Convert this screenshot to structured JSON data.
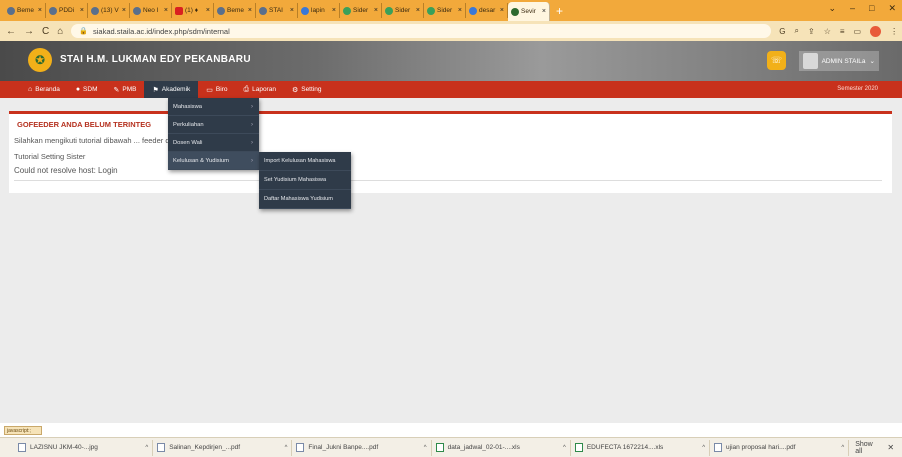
{
  "browser": {
    "tabs": [
      {
        "label": "Beme"
      },
      {
        "label": "PDDi"
      },
      {
        "label": "(13) V"
      },
      {
        "label": "Neo I"
      },
      {
        "label": "(1) ♦"
      },
      {
        "label": "Beme"
      },
      {
        "label": "STAI"
      },
      {
        "label": "lapin"
      },
      {
        "label": "Sider"
      },
      {
        "label": "Sider"
      },
      {
        "label": "Sider"
      },
      {
        "label": "desar"
      },
      {
        "label": "Sevir",
        "active": true
      }
    ],
    "new_tab": "+",
    "url": "siakad.staila.ac.id/index.php/sdm/internal"
  },
  "site": {
    "title": "STAI H.M. LUKMAN EDY PEKANBARU",
    "user": "ADMIN STAILa",
    "semester": "Semester 2020"
  },
  "menu": {
    "items": [
      {
        "label": "Beranda",
        "icon": "home-icon"
      },
      {
        "label": "SDM",
        "icon": "user-icon"
      },
      {
        "label": "PMB",
        "icon": "pin-icon"
      },
      {
        "label": "Akademik",
        "icon": "flag-icon",
        "active": true
      },
      {
        "label": "Biro",
        "icon": "folder-icon"
      },
      {
        "label": "Laporan",
        "icon": "print-icon"
      },
      {
        "label": "Setting",
        "icon": "gear-icon"
      }
    ]
  },
  "dropdown": {
    "items": [
      {
        "label": "Mahasiswa",
        "submenu": true
      },
      {
        "label": "Perkuliahan",
        "submenu": true
      },
      {
        "label": "Dosen Wali",
        "submenu": true
      },
      {
        "label": "Kelulusan & Yudisium",
        "submenu": true,
        "selected": true
      }
    ],
    "submenu": [
      {
        "label": "Import Kelulusan Mahasiswa"
      },
      {
        "label": "Set Yudisium Mahasiswa"
      },
      {
        "label": "Daftar Mahasiswa Yudisium"
      }
    ]
  },
  "main": {
    "warning_title": "GOFEEDER ANDA BELUM TERINTEG",
    "warning_text": "Silahkan mengikuti tutorial dibawah ... feeder dengan SISTER",
    "tutorial_link": "Tutorial Setting Sister",
    "error": "Could not resolve host: Login"
  },
  "status": {
    "text": "javascript:;"
  },
  "downloads": {
    "items": [
      {
        "name": "LAZISNU JKM-40-...jpg"
      },
      {
        "name": "Salinan_Kepdirjen_...pdf"
      },
      {
        "name": "Final_Jukni Banpe....pdf"
      },
      {
        "name": "data_jadwal_02-01-....xls"
      },
      {
        "name": "EDUFECTA 1672214....xls"
      },
      {
        "name": "ujian proposal hari....pdf"
      }
    ],
    "show_all": "Show all"
  }
}
